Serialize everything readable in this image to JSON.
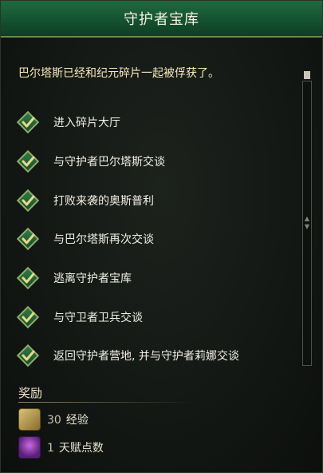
{
  "window": {
    "title": "守护者宝库"
  },
  "description": "巴尔塔斯已经和纪元碎片一起被俘获了。",
  "objectives": [
    {
      "label": "进入碎片大厅",
      "done": true
    },
    {
      "label": "与守护者巴尔塔斯交谈",
      "done": true
    },
    {
      "label": "打败来袭的奥斯普利",
      "done": true
    },
    {
      "label": "与巴尔塔斯再次交谈",
      "done": true
    },
    {
      "label": "逃离守护者宝库",
      "done": true
    },
    {
      "label": "与守卫者卫兵交谈",
      "done": true
    },
    {
      "label": "返回守护者营地, 并与守护者莉娜交谈",
      "done": true
    }
  ],
  "rewards": {
    "title": "奖励",
    "items": [
      {
        "value": "30",
        "label": "经验",
        "icon": "xp-scroll-icon"
      },
      {
        "value": "1",
        "label": "天赋点数",
        "icon": "talent-point-icon"
      }
    ]
  },
  "colors": {
    "title_bar": "#1f6a3f",
    "check_green": "#2f7a48",
    "check_border": "#8fb065",
    "description_text": "#f4e9b8"
  }
}
